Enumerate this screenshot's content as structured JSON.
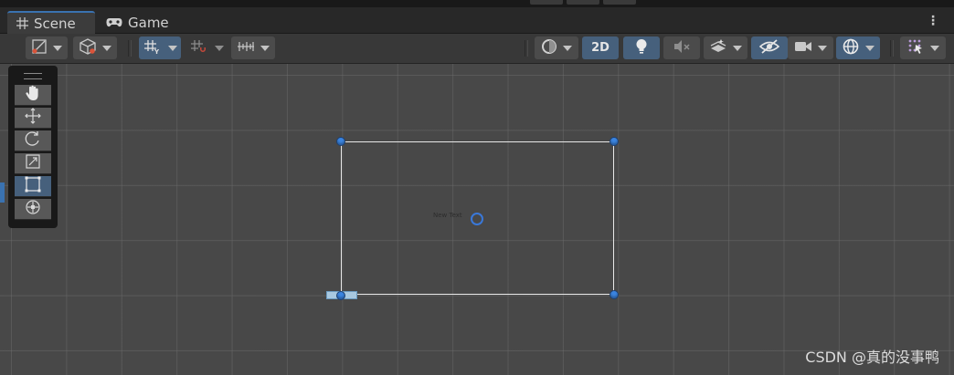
{
  "tabs": [
    {
      "label": "Scene",
      "icon": "grid-icon",
      "active": true
    },
    {
      "label": "Game",
      "icon": "gamepad-icon",
      "active": false
    }
  ],
  "toolbar": {
    "mode_2d_label": "2D"
  },
  "tools": [
    "hand-tool",
    "move-tool",
    "rotate-tool",
    "scale-tool",
    "rect-tool",
    "transform-tool"
  ],
  "selected_tool": "rect-tool",
  "scene": {
    "object_label": "New Text"
  },
  "watermark": "CSDN @真的没事鸭",
  "colors": {
    "accent": "#3a72b0",
    "selected_button": "#46607c",
    "handle": "#3b84e0"
  }
}
